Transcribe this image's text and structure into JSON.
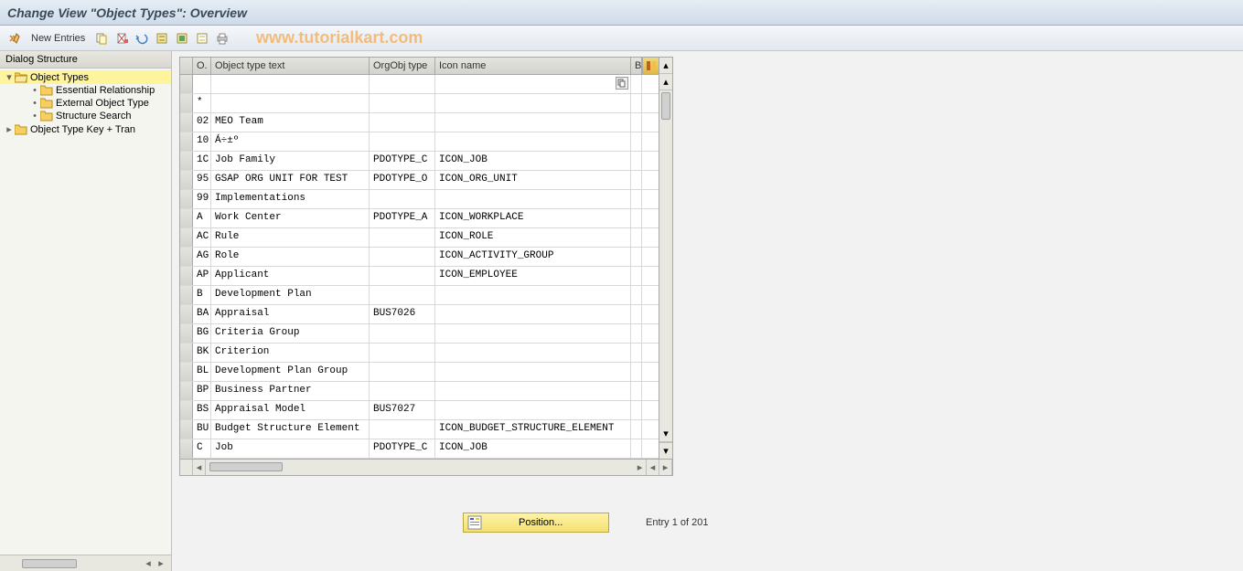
{
  "title": "Change View \"Object Types\": Overview",
  "toolbar": {
    "new_entries": "New Entries"
  },
  "watermark": "www.tutorialkart.com",
  "sidebar": {
    "header": "Dialog Structure",
    "nodes": [
      {
        "label": "Object Types",
        "expanded": true,
        "selected": true,
        "open_folder": true,
        "children": [
          {
            "label": "Essential Relationship"
          },
          {
            "label": "External Object Type"
          },
          {
            "label": "Structure Search"
          }
        ]
      },
      {
        "label": "Object Type Key + Tran",
        "expanded": false
      }
    ]
  },
  "grid": {
    "headers": {
      "o": "O.",
      "text": "Object type text",
      "org": "OrgObj type",
      "icon": "Icon name",
      "b": "B"
    },
    "rows": [
      {
        "o": "",
        "text": "",
        "org": "",
        "icon": "",
        "f4": true
      },
      {
        "o": "*",
        "text": "",
        "org": "",
        "icon": ""
      },
      {
        "o": "02",
        "text": "MEO Team",
        "org": "",
        "icon": ""
      },
      {
        "o": "10",
        "text": "Á÷±º",
        "org": "",
        "icon": ""
      },
      {
        "o": "1C",
        "text": "Job Family",
        "org": "PDOTYPE_C",
        "icon": "ICON_JOB"
      },
      {
        "o": "95",
        "text": "GSAP ORG UNIT FOR TEST",
        "org": "PDOTYPE_O",
        "icon": "ICON_ORG_UNIT"
      },
      {
        "o": "99",
        "text": "Implementations",
        "org": "",
        "icon": ""
      },
      {
        "o": "A",
        "text": "Work Center",
        "org": "PDOTYPE_A",
        "icon": "ICON_WORKPLACE"
      },
      {
        "o": "AC",
        "text": "Rule",
        "org": "",
        "icon": "ICON_ROLE"
      },
      {
        "o": "AG",
        "text": "Role",
        "org": "",
        "icon": "ICON_ACTIVITY_GROUP"
      },
      {
        "o": "AP",
        "text": "Applicant",
        "org": "",
        "icon": "ICON_EMPLOYEE"
      },
      {
        "o": "B",
        "text": "Development Plan",
        "org": "",
        "icon": ""
      },
      {
        "o": "BA",
        "text": "Appraisal",
        "org": "BUS7026",
        "icon": ""
      },
      {
        "o": "BG",
        "text": "Criteria Group",
        "org": "",
        "icon": ""
      },
      {
        "o": "BK",
        "text": "Criterion",
        "org": "",
        "icon": ""
      },
      {
        "o": "BL",
        "text": "Development Plan Group",
        "org": "",
        "icon": ""
      },
      {
        "o": "BP",
        "text": "Business Partner",
        "org": "",
        "icon": ""
      },
      {
        "o": "BS",
        "text": "Appraisal Model",
        "org": "BUS7027",
        "icon": ""
      },
      {
        "o": "BU",
        "text": "Budget Structure Element",
        "org": "",
        "icon": "ICON_BUDGET_STRUCTURE_ELEMENT"
      },
      {
        "o": "C",
        "text": "Job",
        "org": "PDOTYPE_C",
        "icon": "ICON_JOB"
      }
    ]
  },
  "footer": {
    "position_label": "Position...",
    "entry_text": "Entry 1 of 201"
  }
}
